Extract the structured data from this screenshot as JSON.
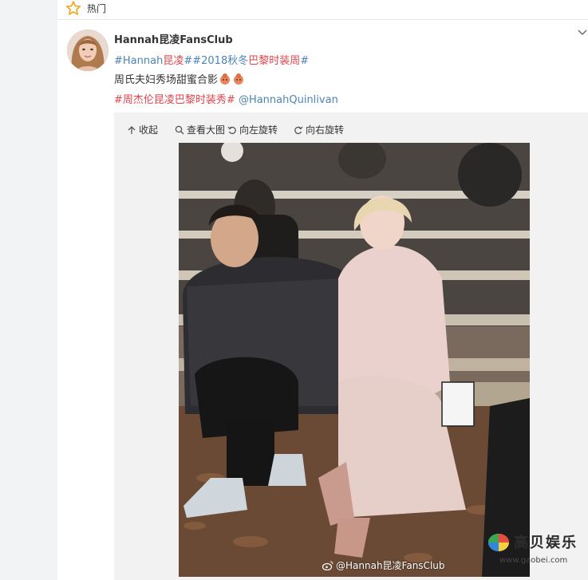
{
  "top_bar": {
    "hot_label": "热门"
  },
  "post": {
    "username": "Hannah昆凌FansClub",
    "line1": {
      "tag1_a": "#Hannah",
      "tag1_b": "昆凌",
      "tag1_c": "##2018秋冬",
      "tag1_d": "巴黎时装周",
      "tag1_e": "#"
    },
    "line2": {
      "text": "周氏夫妇秀场甜蜜合影"
    },
    "line3": {
      "tag": "#周杰伦昆凌巴黎时装秀#",
      "mention": "@HannahQuinlivan"
    }
  },
  "toolbar": {
    "fold": "收起",
    "view_large": "查看大图",
    "rotate_left": "向左旋转",
    "rotate_right": "向右旋转"
  },
  "photo": {
    "watermark": "@Hannah昆凌FansClub"
  },
  "corner_watermark": {
    "title": "高贝娱乐",
    "url": "www.gaobei.com"
  },
  "colors": {
    "link_blue": "#4d84b6",
    "link_red": "#e2454e",
    "star_orange": "#f7a21b"
  }
}
